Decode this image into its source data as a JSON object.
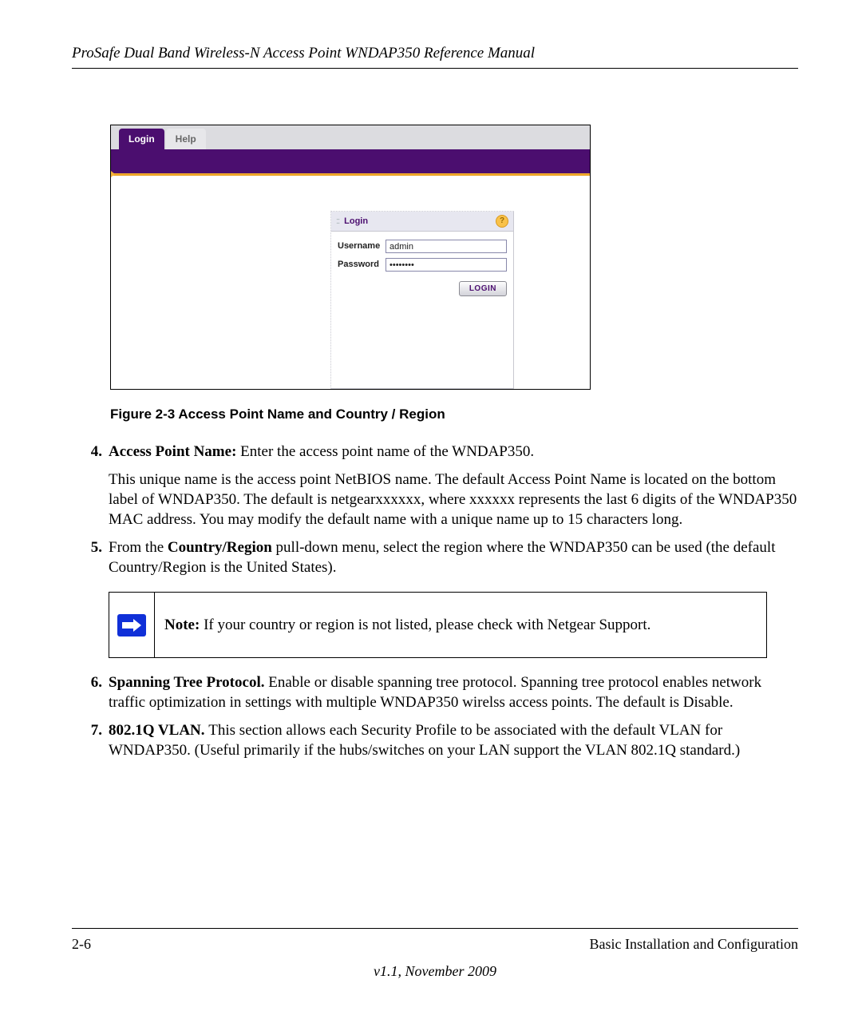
{
  "header": {
    "title": "ProSafe Dual Band Wireless-N Access Point WNDAP350 Reference Manual"
  },
  "screenshot": {
    "tabs": {
      "login": "Login",
      "help": "Help"
    },
    "panel": {
      "title": "Login",
      "help_icon": "?",
      "username_label": "Username",
      "username_value": "admin",
      "password_label": "Password",
      "password_value": "••••••••",
      "login_button": "LOGIN"
    }
  },
  "figure_caption": "Figure 2-3  Access Point Name and Country / Region",
  "items": {
    "i4": {
      "num": "4.",
      "lead": "Access Point Name: ",
      "text": "Enter the access point name of the WNDAP350.",
      "para2": "This unique name is the access point NetBIOS name. The default Access Point Name is located on the bottom label of WNDAP350. The default is netgearxxxxxx, where xxxxxx represents the last 6 digits of the WNDAP350 MAC address. You may modify the default name with a unique name up to 15 characters long."
    },
    "i5": {
      "num": "5.",
      "pre": "From the ",
      "bold": "Country/Region",
      "post": " pull-down menu, select the region where the WNDAP350 can be used (the default Country/Region is the United States)."
    },
    "note": {
      "lead": "Note: ",
      "text": "If your country or region is not listed, please check with Netgear Support."
    },
    "i6": {
      "num": "6.",
      "lead": "Spanning Tree Protocol. ",
      "text": "Enable or disable spanning tree protocol. Spanning tree protocol enables network traffic optimization in settings with multiple WNDAP350 wirelss access points. The default is Disable."
    },
    "i7": {
      "num": "7.",
      "lead": "802.1Q VLAN. ",
      "text": "This section allows each Security Profile to be associated with the default VLAN for WNDAP350. (Useful primarily if the hubs/switches on your LAN support the VLAN 802.1Q standard.)"
    }
  },
  "footer": {
    "page": "2-6",
    "section": "Basic Installation and Configuration",
    "version": "v1.1, November 2009"
  }
}
